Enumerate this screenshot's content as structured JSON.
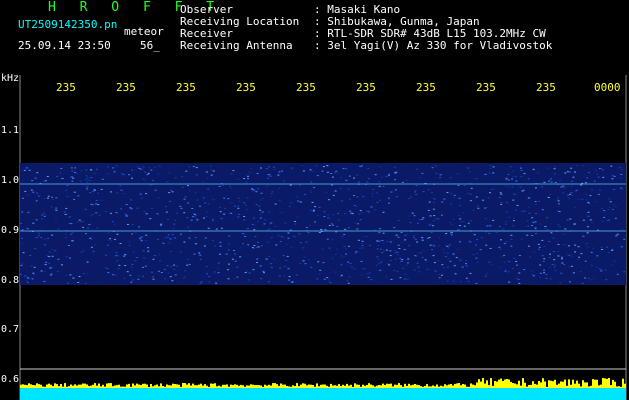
{
  "header": {
    "title": "H R O F F T",
    "filename": "UT2509142350.pn",
    "meteor_label": "meteor",
    "timestamp": "25.09.14 23:50",
    "fps": "56_"
  },
  "info": [
    {
      "label": "Observer",
      "value": ": Masaki Kano"
    },
    {
      "label": "Receiving Location",
      "value": ": Shibukawa, Gunma, Japan"
    },
    {
      "label": "Receiver",
      "value": ": RTL-SDR SDR# 43dB L15 103.2MHz CW"
    },
    {
      "label": "Receiving Antenna",
      "value": ": 3el Yagi(V) Az 330 for Vladivostok"
    }
  ],
  "axis": {
    "unit": "kHz",
    "y_ticks": [
      "1.1",
      "1.0",
      "0.9",
      "0.8",
      "0.7",
      "0.6"
    ],
    "x_ticks": [
      "235",
      "235",
      "235",
      "235",
      "235",
      "235",
      "235",
      "235",
      "235",
      "0000"
    ]
  },
  "colors": {
    "background": "#000000",
    "title": "#22ff22",
    "text": "#ffffff",
    "time_labels": "#ffff33",
    "baseline": "#00ffff",
    "signal": "#ffff00"
  }
}
